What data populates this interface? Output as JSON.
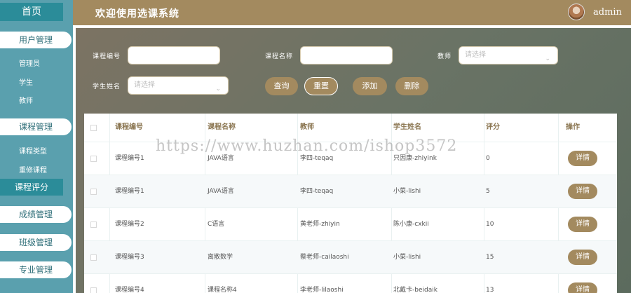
{
  "sidebar": {
    "home": "首页",
    "groups": [
      {
        "label": "用户管理",
        "items": [
          "管理员",
          "学生",
          "教师"
        ]
      },
      {
        "label": "课程管理",
        "items": [
          "课程类型",
          "重修课程"
        ]
      }
    ],
    "active_item": "课程评分",
    "more_groups": [
      "成绩管理",
      "班级管理",
      "专业管理"
    ]
  },
  "header": {
    "title": "欢迎使用选课系统",
    "username": "admin"
  },
  "filters": {
    "course_code_label": "课程编号",
    "course_code_value": "",
    "course_name_label": "课程名称",
    "course_name_value": "",
    "teacher_label": "教师",
    "teacher_placeholder": "请选择",
    "student_label": "学生姓名",
    "student_placeholder": "请选择",
    "buttons": {
      "search": "查询",
      "reset": "重置",
      "add": "添加",
      "delete": "删除"
    }
  },
  "table": {
    "headers": [
      "课程编号",
      "课程名称",
      "教师",
      "学生姓名",
      "评分",
      "操作"
    ],
    "detail_label": "详情",
    "rows": [
      [
        "课程编号1",
        "JAVA语言",
        "李四-teqaq",
        "只因康-zhiyink",
        "0"
      ],
      [
        "课程编号1",
        "JAVA语言",
        "李四-teqaq",
        "小菜-lishi",
        "5"
      ],
      [
        "课程编号2",
        "C语言",
        "黄老师-zhiyin",
        "陈小康-cxkii",
        "10"
      ],
      [
        "课程编号3",
        "离散数学",
        "蔡老师-cailaoshi",
        "小菜-lishi",
        "15"
      ],
      [
        "课程编号4",
        "课程名称4",
        "李老师-lilaoshi",
        "北戴卡-beidaik",
        "13"
      ]
    ]
  },
  "watermark": "https://www.huzhan.com/ishop3572"
}
